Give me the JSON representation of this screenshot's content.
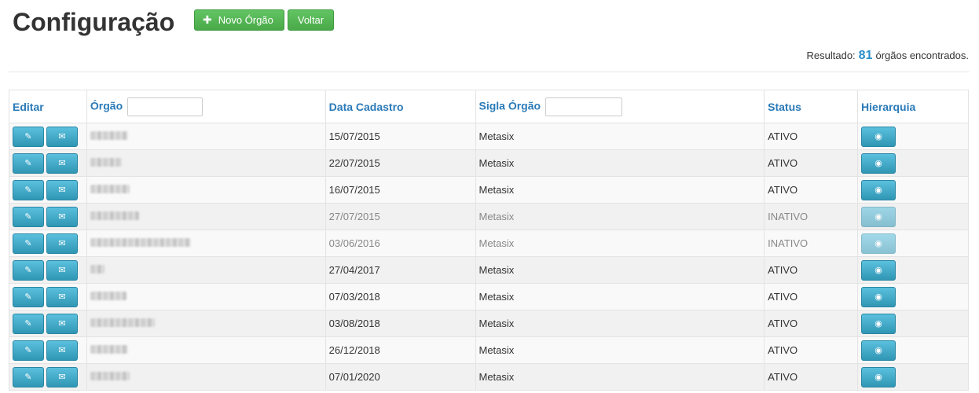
{
  "header": {
    "title": "Configuração",
    "new_button_label": "Novo Órgão",
    "back_button_label": "Voltar"
  },
  "result": {
    "prefix": "Resultado:",
    "count": "81",
    "suffix": "órgãos encontrados."
  },
  "table": {
    "columns": {
      "editar": "Editar",
      "orgao": "Órgão",
      "data": "Data Cadastro",
      "sigla": "Sigla Órgão",
      "status": "Status",
      "hierarquia": "Hierarquia"
    },
    "rows": [
      {
        "data": "15/07/2015",
        "sigla": "Metasix",
        "status": "ATIVO"
      },
      {
        "data": "22/07/2015",
        "sigla": "Metasix",
        "status": "ATIVO"
      },
      {
        "data": "16/07/2015",
        "sigla": "Metasix",
        "status": "ATIVO"
      },
      {
        "data": "27/07/2015",
        "sigla": "Metasix",
        "status": "INATIVO"
      },
      {
        "data": "03/06/2016",
        "sigla": "Metasix",
        "status": "INATIVO"
      },
      {
        "data": "27/04/2017",
        "sigla": "Metasix",
        "status": "ATIVO"
      },
      {
        "data": "07/03/2018",
        "sigla": "Metasix",
        "status": "ATIVO"
      },
      {
        "data": "03/08/2018",
        "sigla": "Metasix",
        "status": "ATIVO"
      },
      {
        "data": "26/12/2018",
        "sigla": "Metasix",
        "status": "ATIVO"
      },
      {
        "data": "07/01/2020",
        "sigla": "Metasix",
        "status": "ATIVO"
      }
    ]
  },
  "icons": {
    "edit": "edit-icon",
    "mail": "envelope-icon",
    "view": "eye-icon",
    "add": "plus-icon"
  },
  "colors": {
    "link_blue": "#2a7ab8",
    "button_green": "#5cb85c",
    "button_info": "#2f96b4"
  }
}
